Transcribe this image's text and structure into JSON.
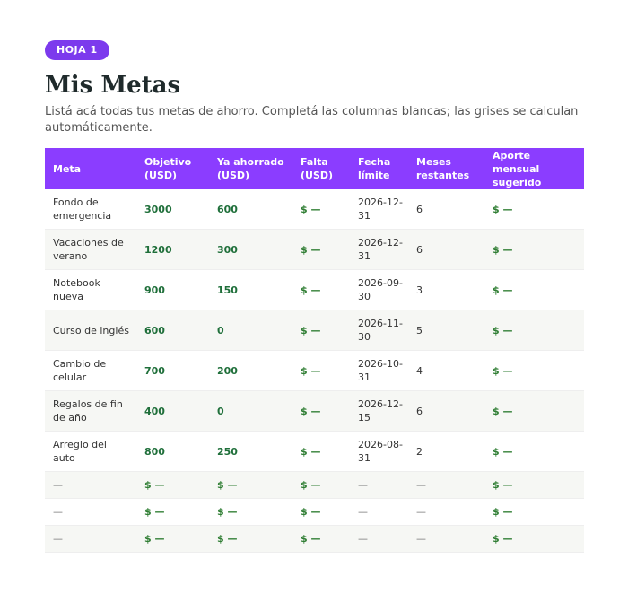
{
  "badge": "HOJA 1",
  "title": "Mis Metas",
  "subtitle": "Listá acá todas tus metas de ahorro. Completá las columnas blancas; las grises se calculan automáticamente.",
  "table": {
    "headers": [
      "Meta",
      "Objetivo (USD)",
      "Ya ahorrado (USD)",
      "Falta (USD)",
      "Fecha límite",
      "Meses restantes",
      "Aporte mensual sugerido"
    ],
    "rows": [
      [
        "Fondo de emergencia",
        "3000",
        "600",
        "$ —",
        "2026-12-31",
        "6",
        "$ —"
      ],
      [
        "Vacaciones de verano",
        "1200",
        "300",
        "$ —",
        "2026-12-31",
        "6",
        "$ —"
      ],
      [
        "Notebook nueva",
        "900",
        "150",
        "$ —",
        "2026-09-30",
        "3",
        "$ —"
      ],
      [
        "Curso de inglés",
        "600",
        "0",
        "$ —",
        "2026-11-30",
        "5",
        "$ —"
      ],
      [
        "Cambio de celular",
        "700",
        "200",
        "$ —",
        "2026-10-31",
        "4",
        "$ —"
      ],
      [
        "Regalos de fin de año",
        "400",
        "0",
        "$ —",
        "2026-12-15",
        "6",
        "$ —"
      ],
      [
        "Arreglo del auto",
        "800",
        "250",
        "$ —",
        "2026-08-31",
        "2",
        "$ —"
      ],
      [
        "—",
        "$ —",
        "$ —",
        "$ —",
        "—",
        "—",
        "$ —"
      ],
      [
        "—",
        "$ —",
        "$ —",
        "$ —",
        "—",
        "—",
        "$ —"
      ],
      [
        "—",
        "$ —",
        "$ —",
        "$ —",
        "—",
        "—",
        "$ —"
      ]
    ]
  }
}
